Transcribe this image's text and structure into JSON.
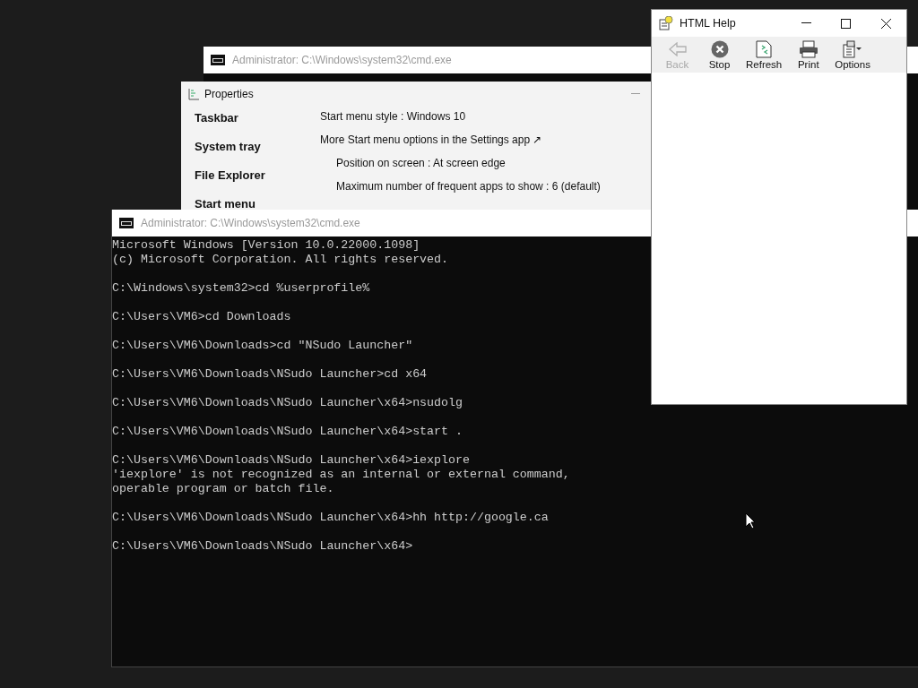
{
  "back_console": {
    "title": "Administrator: C:\\Windows\\system32\\cmd.exe"
  },
  "properties": {
    "title": "Properties",
    "sidebar": [
      "Taskbar",
      "System tray",
      "File Explorer",
      "Start menu"
    ],
    "settings": [
      {
        "text": "Start menu style : Windows 10",
        "kind": "main"
      },
      {
        "text": "More Start menu options in the Settings app ↗",
        "kind": "link"
      },
      {
        "text": "Position on screen : At screen edge",
        "kind": "sub"
      },
      {
        "text": "Maximum number of frequent apps to show : 6 (default)",
        "kind": "sub"
      }
    ]
  },
  "console": {
    "title": "Administrator: C:\\Windows\\system32\\cmd.exe",
    "blocks": [
      [
        "Microsoft Windows [Version 10.0.22000.1098]",
        "(c) Microsoft Corporation. All rights reserved."
      ],
      [
        "C:\\Windows\\system32>cd %userprofile%"
      ],
      [
        "C:\\Users\\VM6>cd Downloads"
      ],
      [
        "C:\\Users\\VM6\\Downloads>cd \"NSudo Launcher\""
      ],
      [
        "C:\\Users\\VM6\\Downloads\\NSudo Launcher>cd x64"
      ],
      [
        "C:\\Users\\VM6\\Downloads\\NSudo Launcher\\x64>nsudolg"
      ],
      [
        "C:\\Users\\VM6\\Downloads\\NSudo Launcher\\x64>start ."
      ],
      [
        "C:\\Users\\VM6\\Downloads\\NSudo Launcher\\x64>iexplore",
        "'iexplore' is not recognized as an internal or external command,",
        "operable program or batch file."
      ],
      [
        "C:\\Users\\VM6\\Downloads\\NSudo Launcher\\x64>hh http://google.ca"
      ],
      [
        "C:\\Users\\VM6\\Downloads\\NSudo Launcher\\x64>"
      ]
    ]
  },
  "help": {
    "title": "HTML Help",
    "toolbar": [
      {
        "label": "Back",
        "kind": "back",
        "disabled": true
      },
      {
        "label": "Stop",
        "kind": "stop",
        "disabled": false
      },
      {
        "label": "Refresh",
        "kind": "refresh",
        "disabled": false
      },
      {
        "label": "Print",
        "kind": "print",
        "disabled": false
      },
      {
        "label": "Options",
        "kind": "options",
        "disabled": false
      }
    ]
  }
}
